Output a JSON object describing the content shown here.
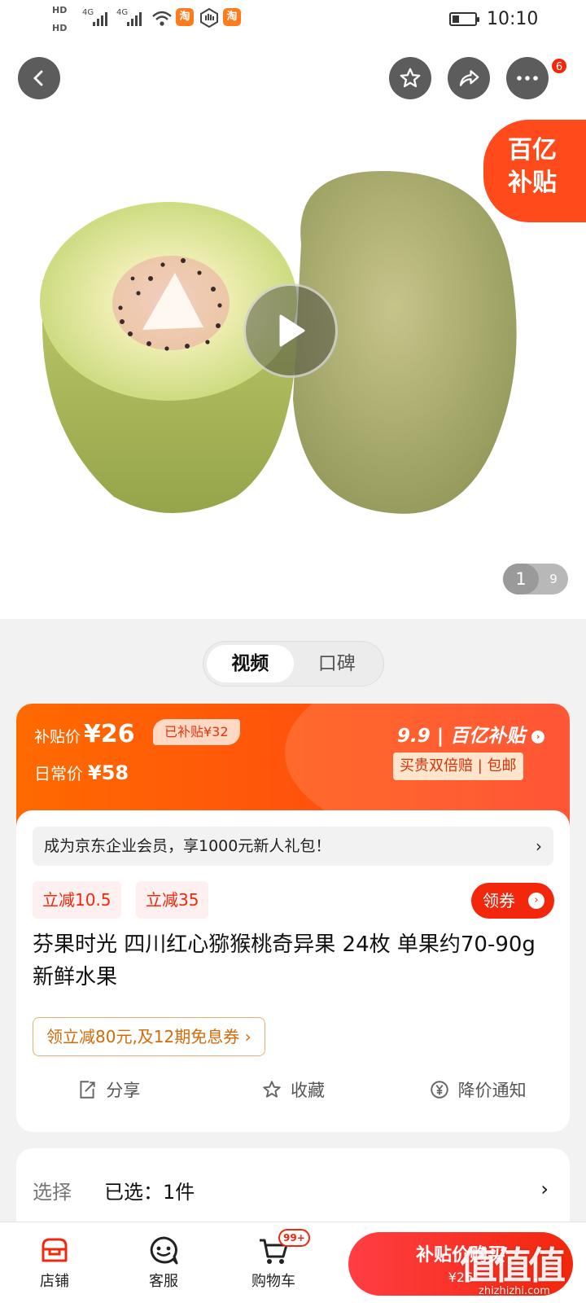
{
  "status_bar": {
    "hd1": "HD",
    "hd2": "HD",
    "sig1": "4G",
    "sig2": "4G",
    "app_icon": "淘",
    "time": "10:10"
  },
  "header": {
    "more_badge": "6"
  },
  "gallery": {
    "subsidy_line1": "百亿",
    "subsidy_line2": "补贴",
    "current_page": "1",
    "total_pages": "9"
  },
  "media_tabs": [
    "视频",
    "口碑"
  ],
  "price": {
    "subsidy_label": "补贴价",
    "subsidy_price": "¥26",
    "subsidized_tag": "已补贴¥32",
    "daily_label": "日常价",
    "daily_price": "¥58",
    "brand_text": "9.9 | 百亿补贴",
    "guarantee": "买贵双倍赔 | 包邮"
  },
  "membership": {
    "text": "成为京东企业会员，享1000元新人礼包！",
    "arrow": "›"
  },
  "coupons": [
    "立减10.5",
    "立减35"
  ],
  "get_coupon": "领券",
  "product_title": "芬果时光 四川红心猕猴桃奇异果 24枚 单果约70-90g 新鲜水果",
  "promo": "领立减80元,及12期免息券 ›",
  "actions": {
    "share": "分享",
    "favorite": "收藏",
    "price_alert": "降价通知"
  },
  "selection": {
    "label": "选择",
    "value": "已选：1件",
    "arrow": "›"
  },
  "bottom_bar": {
    "shop": "店铺",
    "service": "客服",
    "cart": "购物车",
    "cart_badge": "99+",
    "buy_label": "补贴价购买",
    "buy_price": "¥26"
  },
  "watermark": {
    "main": "值值值",
    "sub": "zhizhizhi.com"
  },
  "colors": {
    "accent": "#f2270c",
    "band_start": "#ff6a00",
    "band_end": "#ff3d18",
    "coupon_bg": "#fff0f0",
    "promo_text": "#d46b08"
  }
}
